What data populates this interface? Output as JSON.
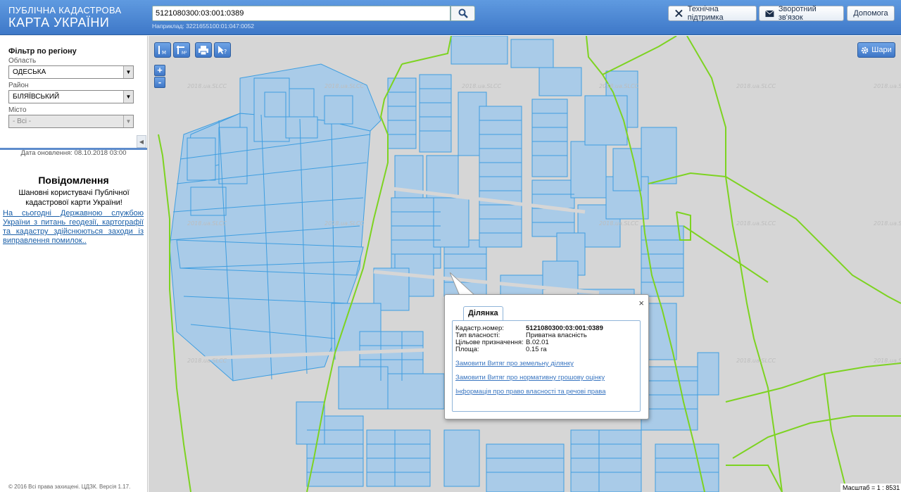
{
  "header": {
    "logo_line1": "ПУБЛІЧНА КАДАСТРОВА",
    "logo_line2": "КАРТА УКРАЇНИ",
    "search_value": "5121080300:03:001:0389",
    "search_hint": "Наприклад: 3221655100:01:047:0052",
    "buttons": {
      "support": "Технічна підтримка",
      "feedback": "Зворотний зв'язок",
      "help": "Допомога"
    }
  },
  "sidebar": {
    "filter_title": "Фільтр по регіону",
    "oblast_label": "Область",
    "oblast_value": "ОДЕСЬКА",
    "raion_label": "Район",
    "raion_value": "БІЛЯЇВСЬКИЙ",
    "misto_label": "Місто",
    "misto_value": "- Всі -",
    "update_date": "Дата оновлення: 08.10.2018 03:00",
    "notice_title": "Повідомлення",
    "notice_greeting": "Шановні користувачі Публічної кадастрової карти України!",
    "notice_link": "На сьогодні Державною службою України з питань геодезії, картографії та кадастру здійснюються заходи із виправлення помилок..",
    "copyright": "© 2016 Всі права захищені. ЦДЗК. Версія 1.17."
  },
  "map": {
    "layers_label": "Шари",
    "watermark": "2018.ua.SLCC",
    "scale": "Масштаб = 1 : 8531",
    "zoom_in": "+",
    "zoom_out": "-"
  },
  "popup": {
    "tab": "Ділянка",
    "close": "×",
    "rows": [
      {
        "key": "Кадастр.номер:",
        "value": "5121080300:03:001:0389"
      },
      {
        "key": "Тип власності:",
        "value": "Приватна власність"
      },
      {
        "key": "Цільове призначення:",
        "value": "В.02.01"
      },
      {
        "key": "Площа:",
        "value": "0.15 га"
      }
    ],
    "links": [
      "Замовити Витяг про земельну ділянку",
      "Замовити Витяг про нормативну грошову оцінку",
      "Інформація про право власності та речові права"
    ]
  },
  "colors": {
    "header": "#3e78c8",
    "parcel_fill": "#a9cbe8",
    "parcel_stroke": "#3f9ee0",
    "boundary": "#7dd321",
    "map_bg": "#d6d6d6"
  }
}
